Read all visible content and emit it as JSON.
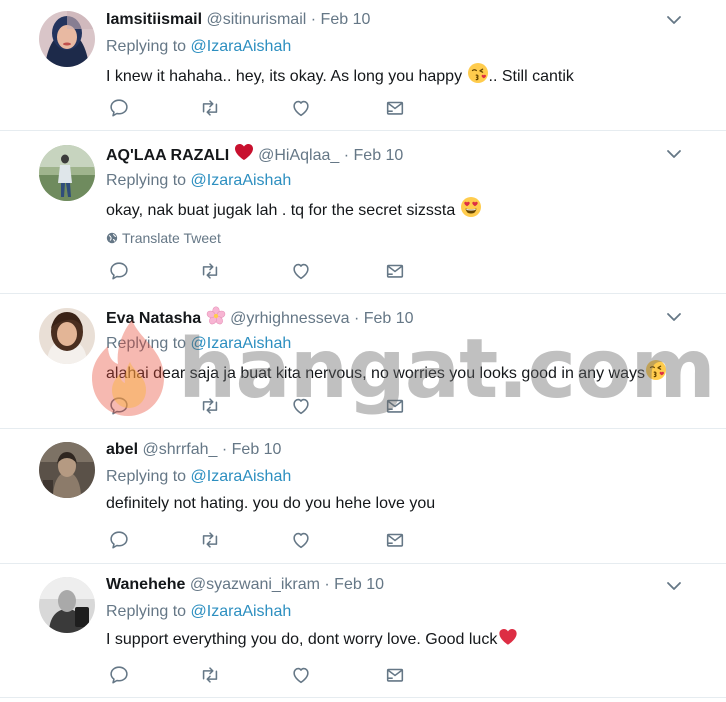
{
  "tweets": [
    {
      "name": "Iamsitiismail",
      "handle": "@sitinurismail",
      "date": "Feb 10",
      "reply_label": "Replying to",
      "reply_handle": "@IzaraAishah",
      "text_before": "I knew it hahaha.. hey, its okay. As long you happy ",
      "text_after": ".. Still cantik",
      "emoji": "kissing-face-emoji"
    },
    {
      "name": "AQ'LAA RAZALI",
      "handle": "@HiAqlaa_",
      "date": "Feb 10",
      "reply_label": "Replying to",
      "reply_handle": "@IzaraAishah",
      "text_before": "okay, nak buat jugak lah . tq for the secret sizssta ",
      "text_after": "",
      "emoji": "heart-eyes-emoji",
      "translate": "Translate Tweet"
    },
    {
      "name": "Eva Natasha",
      "handle": "@yrhighnesseva",
      "date": "Feb 10",
      "reply_label": "Replying to",
      "reply_handle": "@IzaraAishah",
      "text_before": "alahai dear saja ja buat kita nervous, no worries you looks good in any ways",
      "text_after": "",
      "emoji": "kissing-face-emoji"
    },
    {
      "name": "abel",
      "handle": "@shrrfah_",
      "date": "Feb 10",
      "reply_label": "Replying to",
      "reply_handle": "@IzaraAishah",
      "text_before": "definitely not hating. you do you hehe love you",
      "text_after": ""
    },
    {
      "name": "Wanehehe",
      "handle": "@syazwani_ikram",
      "date": "Feb 10",
      "reply_label": "Replying to",
      "reply_handle": "@IzaraAishah",
      "text_before": "I support everything you do, dont worry love. Good luck",
      "text_after": "",
      "emoji": "red-heart-emoji"
    }
  ],
  "separator": "·",
  "watermark": "hangat.com",
  "colors": {
    "text": "#14171a",
    "secondary": "#657786",
    "mention": "#2d8fc0",
    "border": "#e6ecf0",
    "heart": "#e0245e"
  },
  "icons": [
    "reply-icon",
    "retweet-icon",
    "like-icon",
    "direct-message-icon",
    "caret-down-icon",
    "globe-icon"
  ]
}
